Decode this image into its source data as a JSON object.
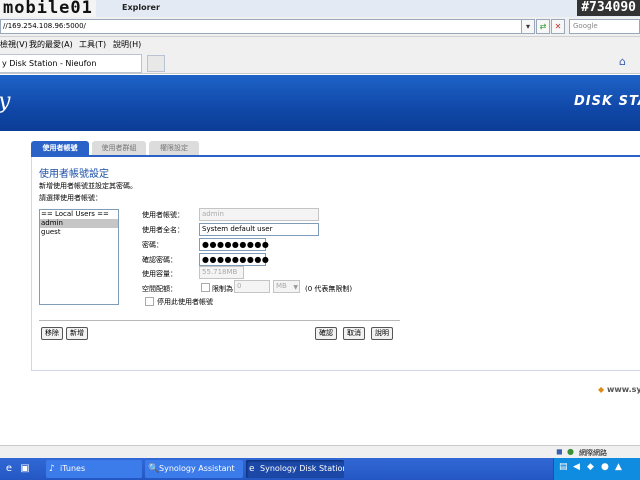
{
  "browser": {
    "watermark": "mobile01",
    "window_title": "Explorer",
    "watermark_number": "#734090",
    "address": "//169.254.108.96:5000/",
    "search_placeholder": "Google",
    "menu": [
      "檢視(V)",
      "我的最愛(A)",
      "工具(T)",
      "說明(H)"
    ],
    "tab_title": "y Disk Station - Nieufon"
  },
  "header": {
    "logo_partial": "y",
    "product": "DISK STA"
  },
  "content_tabs": [
    "使用者帳號",
    "使用者群組",
    "權限設定"
  ],
  "page": {
    "title": "使用者帳號設定",
    "description": "新增使用者帳號並設定其密碼。",
    "select_label": "請選擇使用者帳號："
  },
  "user_list": [
    "== Local Users ==",
    "admin",
    "guest"
  ],
  "form": {
    "username_label": "使用者帳號：",
    "username_value": "admin",
    "fullname_label": "使用者全名：",
    "fullname_value": "System default user",
    "password_label": "密碼：",
    "password_value": "●●●●●●●●●",
    "confirm_label": "確認密碼：",
    "confirm_value": "●●●●●●●●●",
    "capacity_label": "使用容量：",
    "capacity_value": "55.718MB",
    "quota_label": "空間配額：",
    "quota_checkbox_label": "限制為",
    "quota_value": "0",
    "quota_unit": "MB",
    "quota_note": "(0 代表無限制)",
    "disable_label": "停用此使用者帳號"
  },
  "buttons": {
    "remove": "移除",
    "add": "新增",
    "ok": "確認",
    "cancel": "取消",
    "help": "說明"
  },
  "footer": "www.sy",
  "statusbar": {
    "zone": "網際網路"
  },
  "taskbar": {
    "tasks": [
      "iTunes",
      "Synology Assistant",
      "Synology Disk Station ..."
    ]
  }
}
